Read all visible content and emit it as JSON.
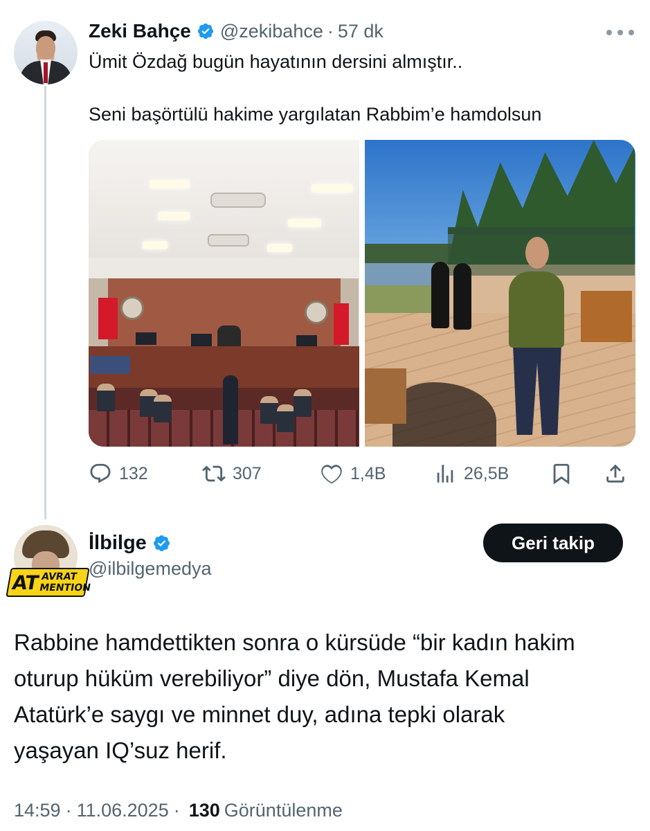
{
  "tweet1": {
    "author_name": "Zeki Bahçe",
    "handle": "@zekibahce",
    "separator": "·",
    "time": "57 dk",
    "text_line1": "Ümit Özdağ bugün hayatının dersini almıştır..",
    "text_line2": "Seni başörtülü hakime yargılatan Rabbim’e hamdolsun",
    "media_icons": [
      "courtroom-photo",
      "outdoor-photo"
    ],
    "actions": {
      "replies": "132",
      "reposts": "307",
      "likes": "1,4B",
      "views": "26,5B"
    }
  },
  "tweet2": {
    "author_name": "İlbilge",
    "handle": "@ilbilgemedya",
    "follow_button": "Geri takip",
    "avatar_badge": {
      "main": "AT",
      "line1": "AVRAT",
      "line2": "MENTION"
    },
    "text_lines": [
      "Rabbine hamdettikten sonra o kürsüde “bir kadın hakim",
      "oturup hüküm verebiliyor” diye dön, Mustafa Kemal",
      "Atatürk’e saygı ve minnet duy, adına tepki olarak",
      "yaşayan IQ’suz herif."
    ],
    "meta": {
      "time": "14:59",
      "date": "11.06.2025",
      "views_count": "130",
      "views_label": "Görüntülenme",
      "separator": "·"
    }
  },
  "colors": {
    "text": "#0f1419",
    "secondary": "#536471",
    "verified": "#1d9bf0",
    "button_bg": "#0f1419",
    "thread_line": "#cfd9de"
  }
}
